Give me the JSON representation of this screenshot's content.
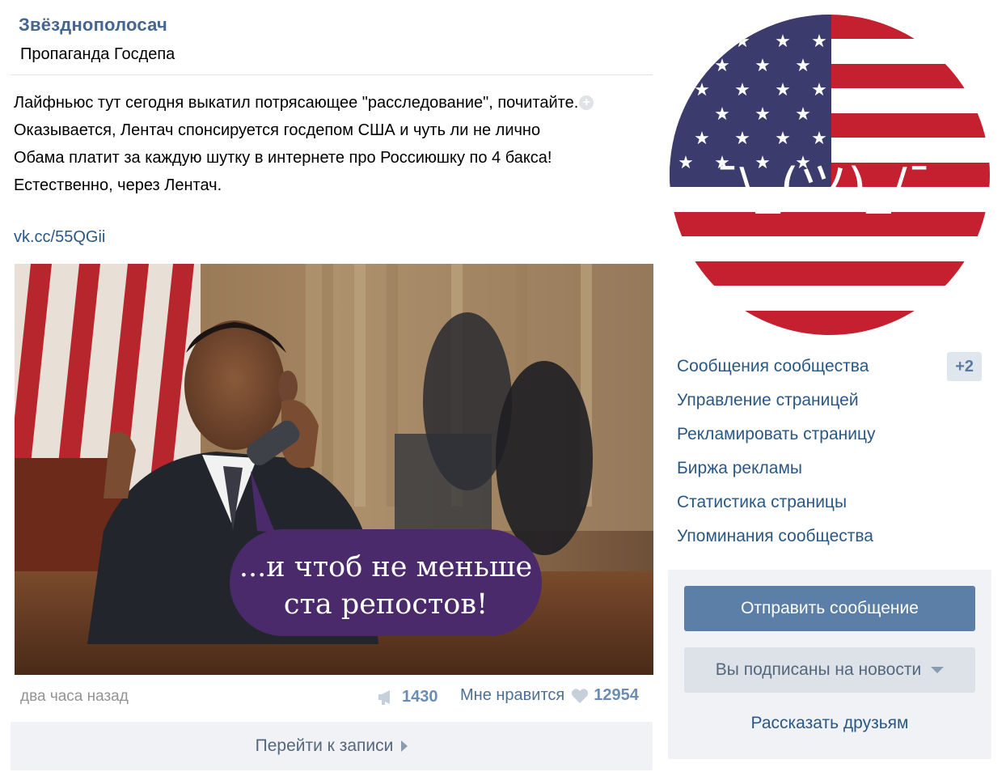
{
  "post": {
    "author": "Звёзднополосач",
    "subtitle": "Пропаганда Госдепа",
    "text_lines": [
      "Лайфньюс тут сегодня выкатил потрясающее \"расследование\", почитайте.",
      "Оказывается, Лентач спонсируется госдепом США и чуть ли не лично",
      "Обама платит за каждую шутку в интернете про Россиюшку по 4 бакса!",
      "Естественно, через Лентач."
    ],
    "link": "vk.cc/55QGii",
    "image": {
      "caption_line1": "...и чтоб не меньше",
      "caption_line2": "ста репостов!"
    },
    "time": "два часа назад",
    "reposts": "1430",
    "like_label": "Мне нравится",
    "likes": "12954",
    "goto_label": "Перейти к записи"
  },
  "sidebar": {
    "avatar_text": "¯\\_(ツ)_/¯",
    "menu": [
      {
        "label": "Сообщения сообщества",
        "badge": "+2"
      },
      {
        "label": "Управление страницей"
      },
      {
        "label": "Рекламировать страницу"
      },
      {
        "label": "Биржа рекламы"
      },
      {
        "label": "Статистика страницы"
      },
      {
        "label": "Упоминания сообщества"
      }
    ],
    "send_message": "Отправить сообщение",
    "subscribed": "Вы подписаны на новости",
    "tell_friends": "Рассказать друзьям"
  },
  "colors": {
    "link": "#2a5885",
    "author": "#45668e",
    "primary_button": "#5b7fa6",
    "flag_red": "#c4202f",
    "flag_blue": "#3c3b6e",
    "bubble": "#4a2a6a"
  }
}
